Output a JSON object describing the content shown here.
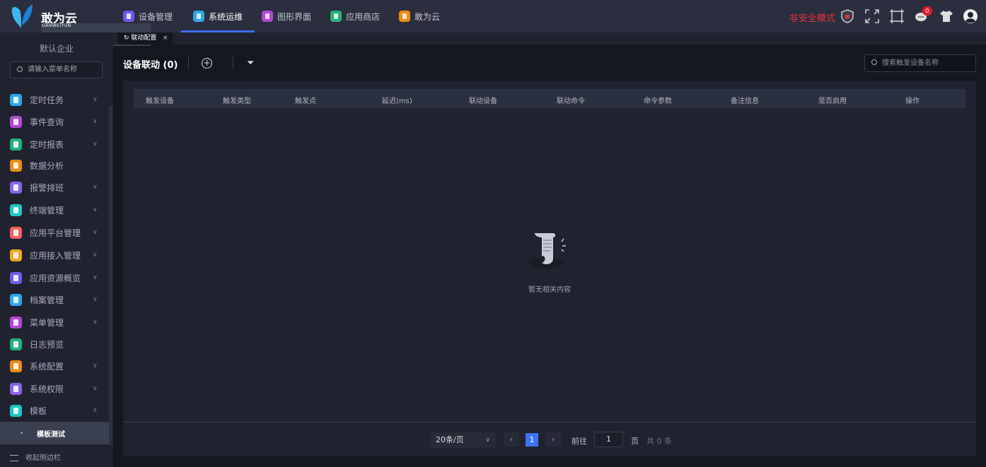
{
  "header": {
    "logo_name": "敢为云",
    "logo_sub": "GANWEIYUN",
    "tabs": [
      {
        "label": "设备管理",
        "color": "#6b5cf0"
      },
      {
        "label": "系统运维",
        "color": "#2fa7e8"
      },
      {
        "label": "图形界面",
        "color": "#b545d8"
      },
      {
        "label": "应用商店",
        "color": "#26b07a"
      },
      {
        "label": "敢为云",
        "color": "#f08a14"
      }
    ],
    "active_tab": "系统运维",
    "unsafe_mode": "非安全模式",
    "message_count": "0"
  },
  "sidebar": {
    "company": "默认企业",
    "search_placeholder": "请输入菜单名称",
    "items": [
      {
        "label": "定时任务",
        "color": "#2fa7e8"
      },
      {
        "label": "事件查询",
        "color": "#b545d8"
      },
      {
        "label": "定时报表",
        "color": "#26b07a"
      },
      {
        "label": "数据分析",
        "color": "#f08a14"
      },
      {
        "label": "报警排班",
        "color": "#8a63e8"
      },
      {
        "label": "终端管理",
        "color": "#1bc6c6"
      },
      {
        "label": "应用平台管理",
        "color": "#ef6464"
      },
      {
        "label": "应用接入管理",
        "color": "#f5a623"
      },
      {
        "label": "应用资源概览",
        "color": "#6b5cf0"
      },
      {
        "label": "档案管理",
        "color": "#2fa7e8"
      },
      {
        "label": "菜单管理",
        "color": "#b545d8"
      },
      {
        "label": "日志预览",
        "color": "#26b07a"
      },
      {
        "label": "系统配置",
        "color": "#f08a14"
      },
      {
        "label": "系统权限",
        "color": "#8a63e8"
      },
      {
        "label": "模板",
        "color": "#1bc6c6"
      }
    ],
    "sub_item": "模板测试",
    "collapse_label": "收起侧边栏"
  },
  "page_tab": {
    "label": "联动配置",
    "close": "×"
  },
  "toolbar": {
    "title": "设备联动 (0)",
    "search_placeholder": "搜索触发设备名称"
  },
  "table": {
    "columns": [
      "触发设备",
      "触发类型",
      "触发点",
      "延迟(ms)",
      "联动设备",
      "联动命令",
      "命令参数",
      "备注信息",
      "是否启用",
      "操作"
    ],
    "empty_text": "暂无相关内容"
  },
  "pagination": {
    "page_size": "20条/页",
    "current_page": "1",
    "goto_label": "前往",
    "goto_value": "1",
    "page_word": "页",
    "total": "共 0 条"
  }
}
